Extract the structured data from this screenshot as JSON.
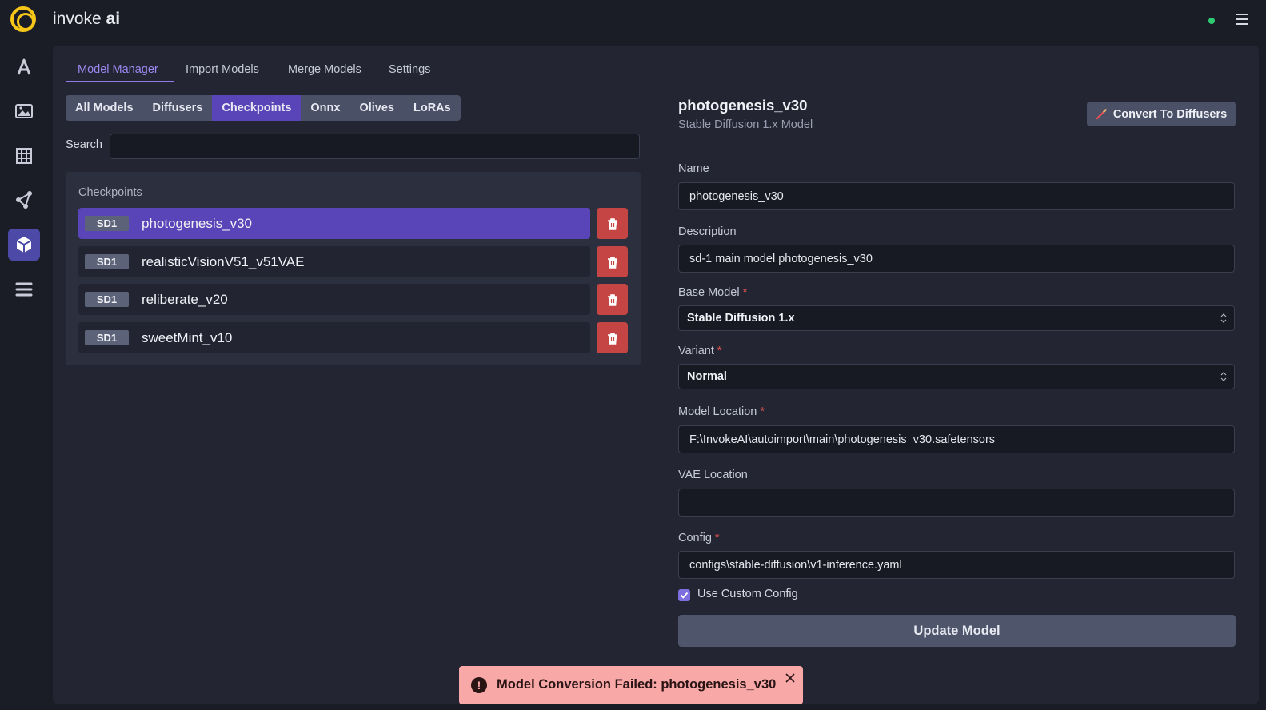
{
  "app": {
    "brand_prefix": "invoke",
    "brand_suffix": "ai",
    "status_color": "#2ecc71",
    "accent": "#5a45b8"
  },
  "rail": {
    "items": [
      {
        "icon": "text-to-image-icon"
      },
      {
        "icon": "image-icon"
      },
      {
        "icon": "canvas-grid-icon"
      },
      {
        "icon": "node-editor-icon"
      },
      {
        "icon": "model-manager-cube-icon",
        "active": true
      },
      {
        "icon": "queue-list-icon"
      }
    ]
  },
  "tabs": [
    "Model Manager",
    "Import Models",
    "Merge Models",
    "Settings"
  ],
  "filters": [
    "All Models",
    "Diffusers",
    "Checkpoints",
    "Onnx",
    "Olives",
    "LoRAs"
  ],
  "active_filter": "Checkpoints",
  "search": {
    "label": "Search",
    "value": ""
  },
  "list": {
    "heading": "Checkpoints",
    "rows": [
      {
        "badge": "SD1",
        "name": "photogenesis_v30",
        "selected": true
      },
      {
        "badge": "SD1",
        "name": "realisticVisionV51_v51VAE"
      },
      {
        "badge": "SD1",
        "name": "reliberate_v20"
      },
      {
        "badge": "SD1",
        "name": "sweetMint_v10"
      }
    ]
  },
  "model": {
    "title": "photogenesis_v30",
    "subtitle": "Stable Diffusion 1.x Model",
    "convert_label": "Convert To Diffusers",
    "fields": {
      "name_label": "Name",
      "name_value": "photogenesis_v30",
      "description_label": "Description",
      "description_value": "sd-1 main model photogenesis_v30",
      "base_label": "Base Model",
      "base_value": "Stable Diffusion 1.x",
      "variant_label": "Variant",
      "variant_value": "Normal",
      "location_label": "Model Location",
      "location_value": "F:\\InvokeAI\\autoimport\\main\\photogenesis_v30.safetensors",
      "vae_label": "VAE Location",
      "vae_value": "",
      "config_label": "Config",
      "config_value": "configs\\stable-diffusion\\v1-inference.yaml",
      "required_mark": "*"
    },
    "custom_config_label": "Use Custom Config",
    "custom_config_checked": true,
    "update_label": "Update Model"
  },
  "toast": {
    "icon": "!",
    "message": "Model Conversion Failed: photogenesis_v30"
  }
}
